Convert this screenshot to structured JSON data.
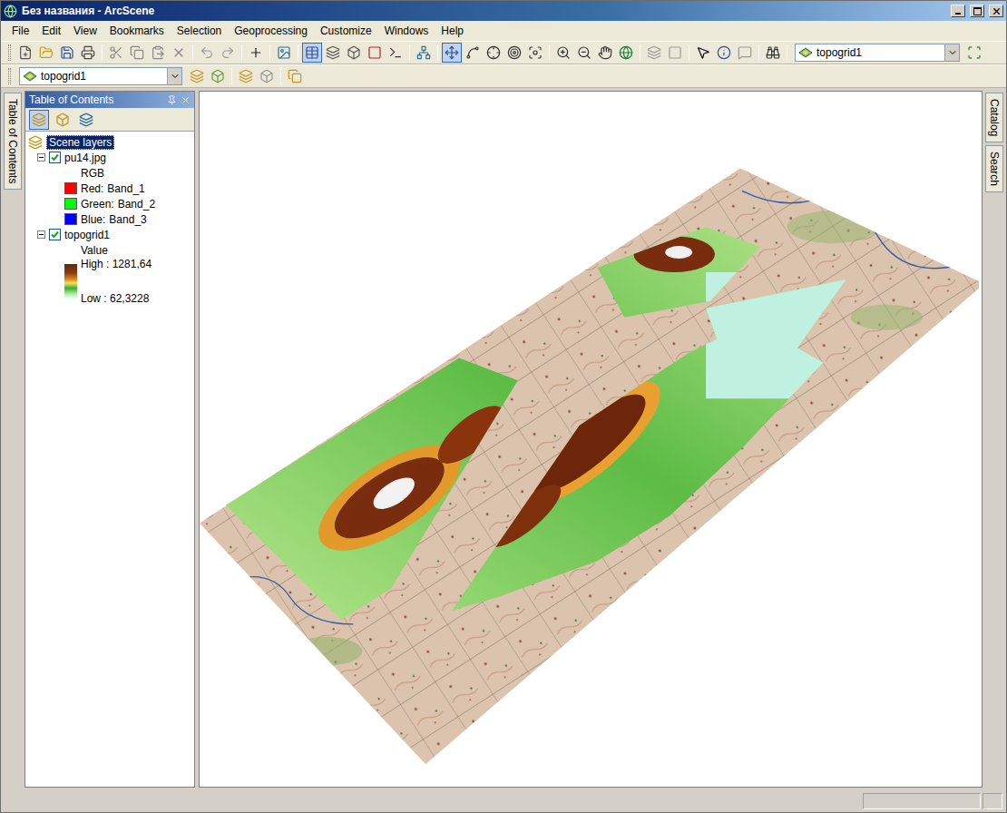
{
  "window": {
    "title": "Без названия - ArcScene"
  },
  "menu": [
    "File",
    "Edit",
    "View",
    "Bookmarks",
    "Selection",
    "Geoprocessing",
    "Customize",
    "Windows",
    "Help"
  ],
  "toolbar": {
    "layer_dropdown": "topogrid1"
  },
  "toolbar2": {
    "layer_dropdown": "topogrid1"
  },
  "left_tabs": [
    "Table of Contents"
  ],
  "right_tabs": [
    "Catalog",
    "Search"
  ],
  "toc": {
    "title": "Table of Contents",
    "root": {
      "label": "Scene layers",
      "selected": true
    },
    "layers": [
      {
        "name": "pu14.jpg",
        "checked": true,
        "expanded": true,
        "kind": "rgb",
        "heading": "RGB",
        "bands": [
          {
            "label": "Red:",
            "band": "Band_1",
            "color": "#ff0000"
          },
          {
            "label": "Green:",
            "band": "Band_2",
            "color": "#00ff00"
          },
          {
            "label": "Blue:",
            "band": "Band_3",
            "color": "#0000ff"
          }
        ]
      },
      {
        "name": "topogrid1",
        "checked": true,
        "expanded": true,
        "kind": "stretch",
        "heading": "Value",
        "high": "High : 1281,64",
        "low": "Low : 62,3228"
      }
    ]
  }
}
